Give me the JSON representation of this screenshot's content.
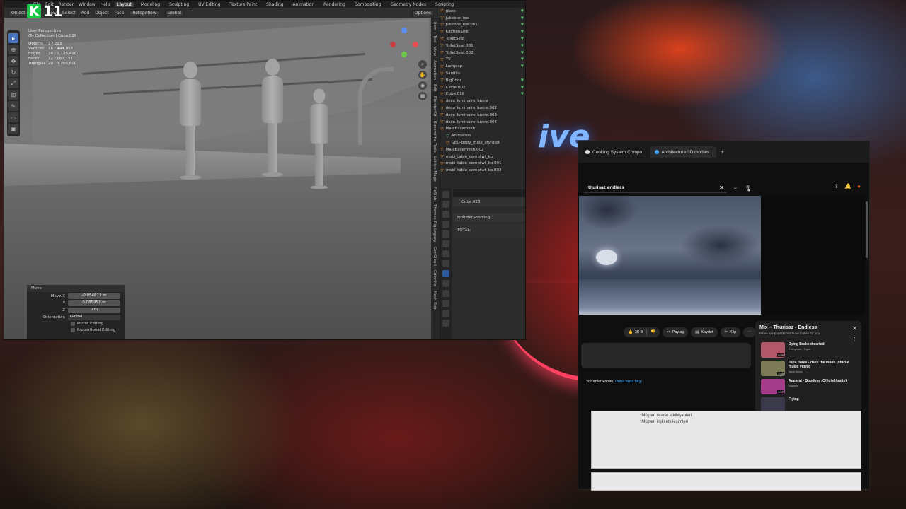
{
  "logo": {
    "letter": "K",
    "number": "11"
  },
  "blender": {
    "menu": [
      "File",
      "Edit",
      "Render",
      "Window",
      "Help"
    ],
    "workspaces": [
      "Layout",
      "Modeling",
      "Sculpting",
      "UV Editing",
      "Texture Paint",
      "Shading",
      "Animation",
      "Rendering",
      "Compositing",
      "Geometry Nodes",
      "Scripting"
    ],
    "active_workspace": "Layout",
    "header": {
      "mode": "Object Mode",
      "view": "View",
      "select": "Select",
      "add": "Add",
      "object": "Object",
      "face": "Face",
      "retopoflow": "Retopoflow",
      "orientation": "Global",
      "options": "Options"
    },
    "viewport_info": {
      "title": "User Perspective",
      "collection": "(6) Collection | Cube.028",
      "stats": [
        {
          "k": "Objects",
          "v": "1 / 223"
        },
        {
          "k": "Vertices",
          "v": "16 / 444,957"
        },
        {
          "k": "Edges",
          "v": "24 / 1,125,490"
        },
        {
          "k": "Faces",
          "v": "12 / 661,151"
        },
        {
          "k": "Triangles",
          "v": "20 / 1,265,600"
        }
      ]
    },
    "sidetabs": [
      "Item",
      "Tool",
      "View",
      "Animation",
      "Edit",
      "BlenderKit",
      "Bonsmithe Tools",
      "Lattice Magic",
      "FixSlab",
      "Themes Rig Legacy",
      "GenCloud",
      "Colorlite",
      "Mesh Rolo"
    ],
    "operator": {
      "title": "Move",
      "move_x_label": "Move X",
      "move_x": "-0.054811 m",
      "y_label": "Y",
      "y": "0.085951 m",
      "z_label": "Z",
      "z": "0 m",
      "orientation_label": "Orientation",
      "orientation": "Global",
      "mirror": "Mirror Editing",
      "proportional": "Proportional Editing"
    },
    "outliner": [
      {
        "name": "glass",
        "type": "mesh"
      },
      {
        "name": "Jukebox_low",
        "type": "mesh"
      },
      {
        "name": "Jukebox_low.001",
        "type": "mesh"
      },
      {
        "name": "KitchenSink",
        "type": "mesh"
      },
      {
        "name": "ToiletSeat",
        "type": "mesh"
      },
      {
        "name": "ToiletSeat.001",
        "type": "mesh"
      },
      {
        "name": "ToiletSeat.002",
        "type": "mesh"
      },
      {
        "name": "TV",
        "type": "mesh"
      },
      {
        "name": "Lamp.sp",
        "type": "mesh"
      },
      {
        "name": "Sanitila",
        "type": "mesh"
      },
      {
        "name": "BigDoor",
        "type": "mesh"
      },
      {
        "name": "Circle.002",
        "type": "mesh"
      },
      {
        "name": "Cube.018",
        "type": "mesh"
      },
      {
        "name": "deco_luminaire_lustre",
        "type": "mesh"
      },
      {
        "name": "deco_luminaire_lustre.002",
        "type": "mesh"
      },
      {
        "name": "deco_luminaire_lustre.003",
        "type": "mesh"
      },
      {
        "name": "deco_luminaire_lustre.004",
        "type": "mesh"
      },
      {
        "name": "MaleBasemesh",
        "type": "mesh"
      },
      {
        "name": "Animation",
        "type": "anim"
      },
      {
        "name": "GEO-body_male_stylized",
        "type": "mesh"
      },
      {
        "name": "MaleBasemesh.002",
        "type": "mesh"
      },
      {
        "name": "mobi_table_comptwt_kp",
        "type": "mesh"
      },
      {
        "name": "mobi_table_comptwt_kp.001",
        "type": "mesh"
      },
      {
        "name": "mobi_table_comptwt_kp.002",
        "type": "mesh"
      }
    ],
    "properties": {
      "object": "Cube.028",
      "section": "Modifier Profiling",
      "total": "TOTAL:"
    }
  },
  "browser": {
    "tabs": [
      {
        "label": "Cooking System Compo...",
        "color": "#e0e0e0"
      },
      {
        "label": "Architecture 3D models |",
        "color": "#4ea3ff"
      }
    ],
    "search_query": "thurisaz endless",
    "actions": {
      "likes": "38 B",
      "share": "Paylaş",
      "save": "Kaydet",
      "clip": "Klip"
    },
    "comments": {
      "text": "Yorumlar kapalı.",
      "link": "Daha fazla bilgi"
    },
    "mix": {
      "title": "Mix – Thurisaz - Endless",
      "subtitle": "Mixes are playlists YouTube makes for you",
      "items": [
        {
          "title": "Dying Brokenhearted",
          "channel": "Empyrium - Topic",
          "duration": "5:35",
          "color": "#b0586a"
        },
        {
          "title": "Ilana flores - rises the moon (official music video)",
          "channel": "Ilana flores",
          "duration": "2:45",
          "color": "#7a7a56"
        },
        {
          "title": "Apparat - Goodbye (Official Audio)",
          "channel": "Apparat",
          "duration": "4:17",
          "color": "#a43c8a"
        },
        {
          "title": "Flying",
          "channel": "",
          "duration": "",
          "color": "#3a3a4a"
        }
      ]
    }
  },
  "document": {
    "lines": [
      "*Müşteri ticaret etkileşimleri",
      "*Müşteri ilişki etkileşimleri"
    ]
  },
  "colors": {
    "blender_bg": "#2b2b2b",
    "viewport": "#6d6d6d",
    "accent": "#4a72b8",
    "youtube_link": "#3ea6ff"
  }
}
